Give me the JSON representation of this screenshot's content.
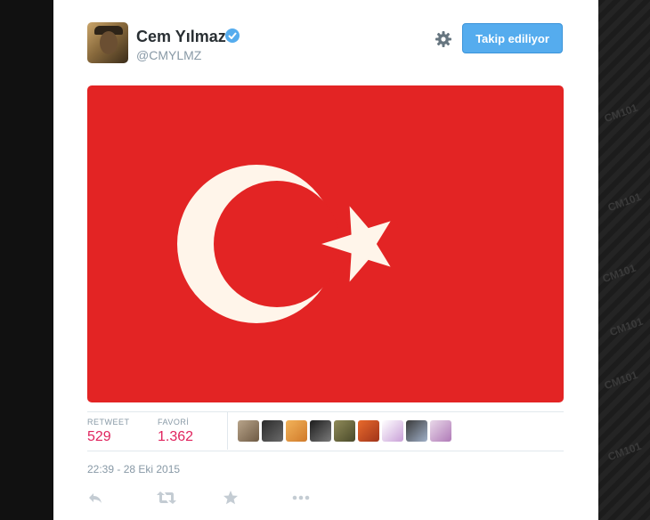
{
  "tweet": {
    "author": {
      "display_name": "Cem Yılmaz",
      "username": "@CMYLMZ",
      "verified": true
    },
    "follow_button_label": "Takip ediliyor",
    "image": {
      "description": "Turkish flag",
      "background_color": "#e32424",
      "emblem_color": "#fff5ea"
    },
    "stats": {
      "retweet_label": "RETWEET",
      "retweet_count": "529",
      "favorite_label": "FAVORİ",
      "favorite_count": "1.362"
    },
    "favoriter_count_shown": 9,
    "timestamp": "22:39 - 28 Eki 2015",
    "actions": [
      "reply-icon",
      "retweet-icon",
      "favorite-icon",
      "more-icon"
    ]
  },
  "colors": {
    "accent": "#55acee",
    "stat_value": "#e0245e",
    "muted": "#8899a6",
    "name": "#292f33"
  },
  "watermark_text": "CM101"
}
